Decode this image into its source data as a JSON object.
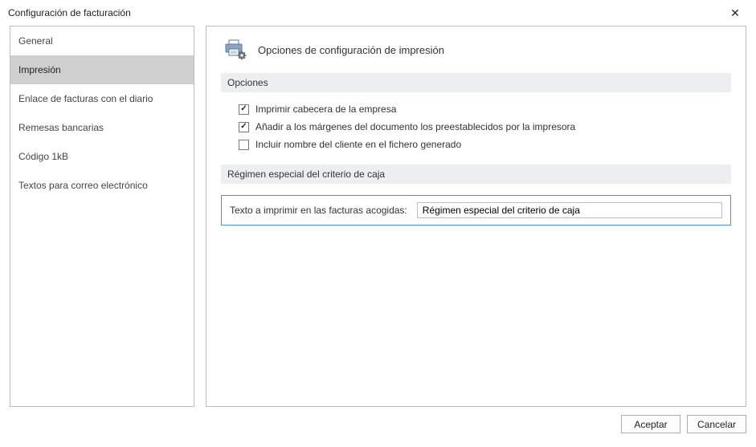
{
  "window": {
    "title": "Configuración de facturación"
  },
  "nav": {
    "items": [
      {
        "label": "General"
      },
      {
        "label": "Impresión"
      },
      {
        "label": "Enlace de facturas con el diario"
      },
      {
        "label": "Remesas bancarias"
      },
      {
        "label": "Código 1kB"
      },
      {
        "label": "Textos para correo electrónico"
      }
    ],
    "selected_index": 1
  },
  "page": {
    "heading": "Opciones de configuración de impresión",
    "section_options": "Opciones",
    "checks": [
      {
        "label": "Imprimir cabecera de la empresa",
        "checked": true
      },
      {
        "label": "Añadir a los márgenes del documento los preestablecidos por la impresora",
        "checked": true
      },
      {
        "label": "Incluir nombre del cliente en el fichero generado",
        "checked": false
      }
    ],
    "section_regimen": "Régimen especial del criterio de caja",
    "regimen": {
      "label": "Texto a imprimir en las facturas acogidas:",
      "value": "Régimen especial del criterio de caja"
    }
  },
  "buttons": {
    "accept": "Aceptar",
    "cancel": "Cancelar"
  }
}
